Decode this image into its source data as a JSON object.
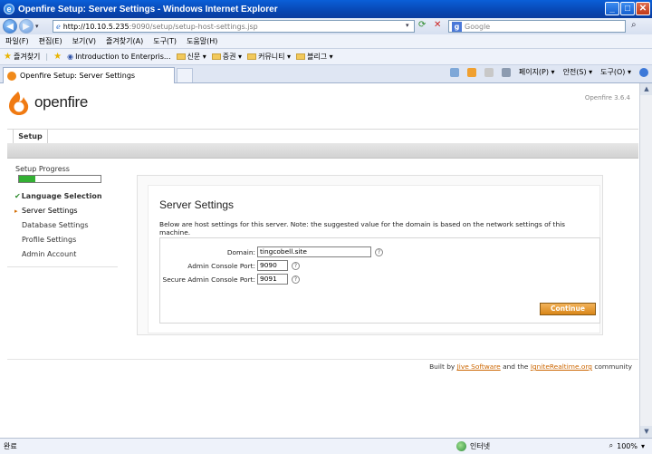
{
  "window": {
    "title": "Openfire Setup: Server Settings - Windows Internet Explorer",
    "min": "_",
    "max": "□",
    "close": "✕"
  },
  "address": {
    "host": "http://10.10.5.235",
    "path": ":9090/setup/setup-host-settings.jsp",
    "search_placeholder": "Google"
  },
  "menu": [
    "파일(F)",
    "편집(E)",
    "보기(V)",
    "즐겨찾기(A)",
    "도구(T)",
    "도움말(H)"
  ],
  "favorites": {
    "label": "즐겨찾기",
    "items": [
      "Introduction to Enterpris...",
      "신문 ▾",
      "증권 ▾",
      "커뮤니티 ▾",
      "블리그 ▾"
    ]
  },
  "tab": {
    "title": "Openfire Setup: Server Settings"
  },
  "commands": [
    "페이지(P) ▾",
    "안전(S) ▾",
    "도구(O) ▾"
  ],
  "status": {
    "left": "완료",
    "zone": "인터넷",
    "zoom": "100%"
  },
  "page": {
    "logo_text": "openfire",
    "version": "Openfire 3.6.4",
    "nav_tab": "Setup",
    "sidebar": {
      "title": "Setup Progress",
      "progress": 0.2,
      "items": [
        {
          "label": "Language Selection",
          "state": "done"
        },
        {
          "label": "Server Settings",
          "state": "active"
        },
        {
          "label": "Database Settings",
          "state": "pending"
        },
        {
          "label": "Profile Settings",
          "state": "pending"
        },
        {
          "label": "Admin Account",
          "state": "pending"
        }
      ]
    },
    "heading": "Server Settings",
    "description": "Below are host settings for this server. Note: the suggested value for the domain is based on the network settings of this machine.",
    "form": {
      "domain_label": "Domain:",
      "domain_value": "tingcobell.site",
      "port_label": "Admin Console Port:",
      "port_value": "9090",
      "secure_port_label": "Secure Admin Console Port:",
      "secure_port_value": "9091",
      "help": "?"
    },
    "continue_label": "Continue",
    "footer": {
      "prefix": "Built by ",
      "link1": "Jive Software",
      "mid": " and the ",
      "link2": "IgniteRealtime.org",
      "suffix": " community"
    }
  }
}
